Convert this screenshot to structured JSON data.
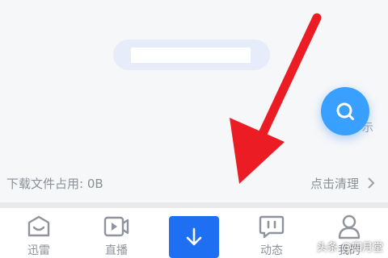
{
  "search_bar": {
    "redacted_text": ""
  },
  "fab": {
    "icon": "search-icon",
    "behind_text": "示"
  },
  "storage": {
    "label": "下载文件占用: 0B",
    "clean_label": "点击清理",
    "clean_icon": "chevron-right-icon"
  },
  "tabs": [
    {
      "label": "迅雷",
      "icon": "home-icon"
    },
    {
      "label": "直播",
      "icon": "video-icon"
    },
    {
      "label": "",
      "icon": "download-icon",
      "selected": true
    },
    {
      "label": "动态",
      "icon": "chat-icon"
    },
    {
      "label": "我的",
      "icon": "user-icon"
    }
  ],
  "annotation": {
    "type": "red-arrow",
    "color": "#ec1c24"
  },
  "watermark": "头条 @四月堂",
  "colors": {
    "accent": "#1e6ff1",
    "fab": "#3aa0ff",
    "annotation": "#ec1c24",
    "muted_text": "#8a8f98"
  }
}
